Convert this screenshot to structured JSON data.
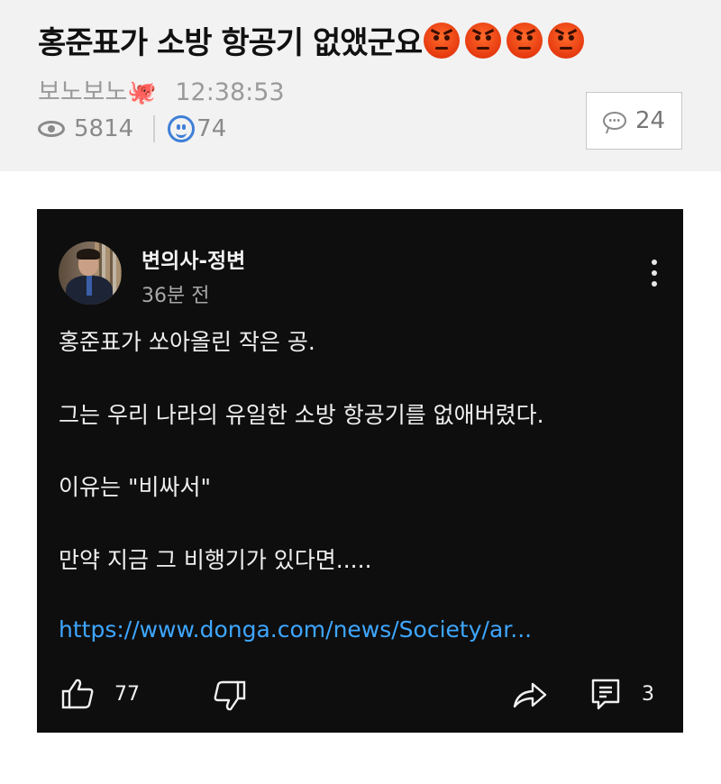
{
  "post": {
    "title": "홍준표가 소방 항공기 없앴군요",
    "emoji_count": 4,
    "author": "보노보노",
    "author_badge": "🐙",
    "time": "12:38:53",
    "views": "5814",
    "likes": "74",
    "comments": "24"
  },
  "card": {
    "channel_name": "변의사-정변",
    "posted_ago": "36분 전",
    "lines": [
      "홍준표가 쏘아올린 작은 공.",
      "그는 우리 나라의 유일한 소방 항공기를 없애버렸다.",
      "이유는 \"비싸서\"",
      "만약 지금 그 비행기가 있다면....."
    ],
    "link": "https://www.donga.com/news/Society/ar...",
    "like_count": "77",
    "reply_count": "3"
  },
  "colors": {
    "header_bg": "#f2f2f2",
    "card_bg": "#0e0e0e",
    "link": "#3ea6ff",
    "reaction_blue": "#3f7fd8"
  },
  "icons": [
    "eye-icon",
    "smiley-icon",
    "comment-bubble-icon",
    "angry-face-icon",
    "more-vert-icon",
    "thumb-up-icon",
    "thumb-down-icon",
    "share-icon",
    "reply-icon"
  ]
}
